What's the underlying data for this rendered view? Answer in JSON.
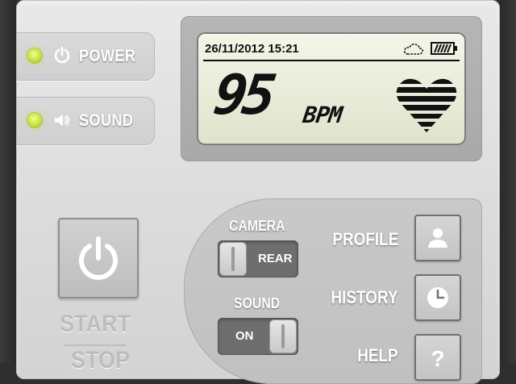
{
  "status": {
    "power": {
      "label": "POWER",
      "icon": "power-icon",
      "led_color": "#cde84e"
    },
    "sound": {
      "label": "SOUND",
      "icon": "speaker-icon",
      "led_color": "#cde84e"
    }
  },
  "display": {
    "datetime": "26/11/2012 15:21",
    "weather_icon": "cloud-icon",
    "battery_icon": "battery-icon",
    "bpm_value": "95",
    "bpm_unit": "BPM",
    "heart_icon": "heart-icon"
  },
  "controls": {
    "start_label": "START",
    "stop_label": "STOP",
    "camera": {
      "label": "CAMERA",
      "value": "REAR"
    },
    "sound": {
      "label": "SOUND",
      "value": "ON"
    },
    "buttons": [
      {
        "label": "PROFILE",
        "icon": "profile-icon"
      },
      {
        "label": "HISTORY",
        "icon": "clock-icon"
      },
      {
        "label": "HELP",
        "icon": "help-icon"
      }
    ]
  }
}
